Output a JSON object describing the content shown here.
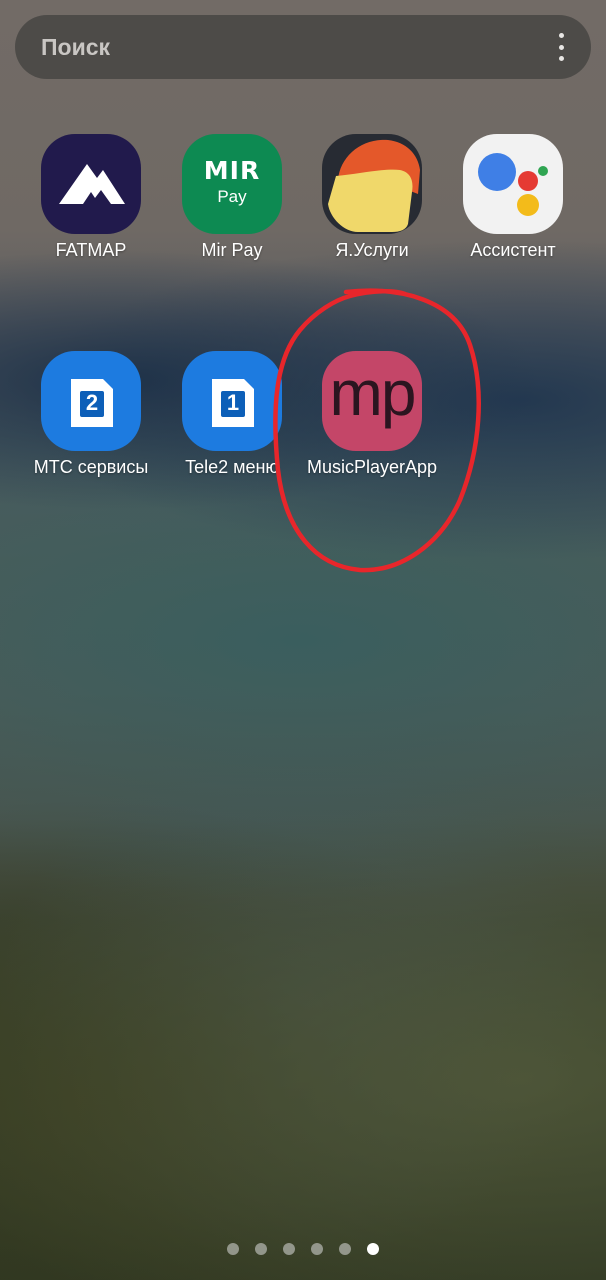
{
  "search": {
    "placeholder": "Поиск",
    "menu_icon": "more-vertical-icon"
  },
  "apps": [
    {
      "label": "FATMAP",
      "icon": "fatmap-mountain-icon",
      "color": "#211a4c"
    },
    {
      "label": "Mir Pay",
      "icon": "mir-pay-icon",
      "color": "#0d8a52",
      "icon_text_top": "MIR",
      "icon_text_bottom": "Pay"
    },
    {
      "label": "Я.Услуги",
      "icon": "yandex-uslugi-icon",
      "color": "#272b33"
    },
    {
      "label": "Ассистент",
      "icon": "google-assistant-icon",
      "color": "#f2f2f2"
    },
    {
      "label": "МТС сервисы",
      "icon": "sim-2-icon",
      "color": "#1d7be0",
      "icon_text": "2"
    },
    {
      "label": "Tele2 меню",
      "icon": "sim-1-icon",
      "color": "#1d7be0",
      "icon_text": "1"
    },
    {
      "label": "MusicPlayerApp",
      "icon": "music-player-app-icon",
      "color": "#c44668",
      "icon_text": "mp",
      "highlighted": true
    }
  ],
  "annotation": {
    "shape": "hand-drawn-circle",
    "color": "#e8262b",
    "target": "MusicPlayerApp"
  },
  "page_indicator": {
    "count": 6,
    "active_index": 5
  }
}
